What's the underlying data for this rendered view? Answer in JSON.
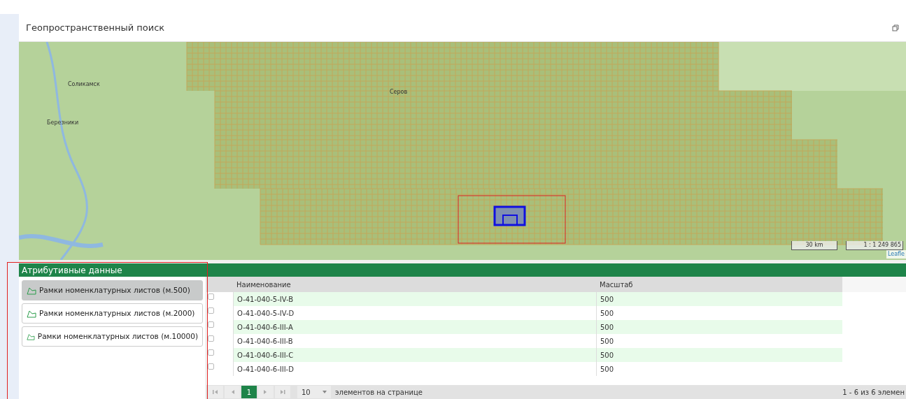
{
  "window": {
    "title": "Геопространственный поиск"
  },
  "map": {
    "labels": [
      {
        "text": "Соликамск"
      },
      {
        "text": "Березники"
      },
      {
        "text": "Серов"
      }
    ],
    "scale": "30 km",
    "ratio": "1 : 1 249 865",
    "attribution": "Leafle"
  },
  "panel": {
    "title": "Атрибутивные данные"
  },
  "layers": [
    {
      "label": "Рамки номенклатурных листов (м.500)",
      "selected": true
    },
    {
      "label": "Рамки номенклатурных листов (м.2000)",
      "selected": false
    },
    {
      "label": "Рамки номенклатурных листов (м.10000)",
      "selected": false
    }
  ],
  "table": {
    "columns": [
      "Наименование",
      "Масштаб"
    ],
    "rows": [
      {
        "checked": false,
        "cells": [
          "O-41-040-5-IV-B",
          "500"
        ]
      },
      {
        "checked": false,
        "cells": [
          "O-41-040-5-IV-D",
          "500"
        ]
      },
      {
        "checked": false,
        "cells": [
          "O-41-040-6-III-A",
          "500"
        ]
      },
      {
        "checked": false,
        "cells": [
          "O-41-040-6-III-B",
          "500"
        ]
      },
      {
        "checked": false,
        "cells": [
          "O-41-040-6-III-C",
          "500"
        ]
      },
      {
        "checked": false,
        "cells": [
          "O-41-040-6-III-D",
          "500"
        ]
      }
    ]
  },
  "pager": {
    "pages": [
      {
        "label": "1",
        "selected": true
      }
    ],
    "page_size": "10",
    "page_size_label": "элементов на странице",
    "summary": "1 - 6 из 6 элемен"
  }
}
